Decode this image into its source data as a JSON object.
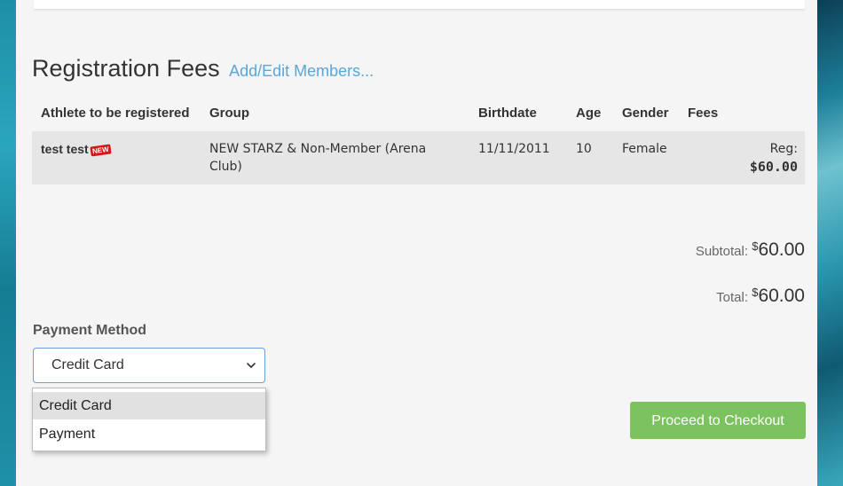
{
  "header": {
    "title": "Registration Fees",
    "edit_link": "Add/Edit Members..."
  },
  "table": {
    "columns": [
      "Athlete to be registered",
      "Group",
      "Birthdate",
      "Age",
      "Gender",
      "Fees"
    ],
    "rows": [
      {
        "athlete": "test test",
        "badge": "NEW",
        "group": "NEW STARZ & Non-Member (Arena Club)",
        "birthdate": "11/11/2011",
        "age": "10",
        "gender": "Female",
        "fee_label": "Reg:",
        "fee_amount": "$60.00"
      }
    ]
  },
  "totals": {
    "subtotal_label": "Subtotal:",
    "subtotal_currency": "$",
    "subtotal_amount": "60.00",
    "total_label": "Total:",
    "total_currency": "$",
    "total_amount": "60.00"
  },
  "payment": {
    "label": "Payment Method",
    "selected": "Credit Card",
    "options": [
      "Credit Card",
      "Payment"
    ]
  },
  "actions": {
    "checkout_label": "Proceed to Checkout"
  },
  "colors": {
    "link": "#5aa6db",
    "checkout_button": "#7cc260",
    "badge": "#d11a1a",
    "select_border": "#6a9fd8"
  },
  "icons": {
    "select_arrow": "chevron-down-icon",
    "new_badge": "new-badge-icon"
  }
}
